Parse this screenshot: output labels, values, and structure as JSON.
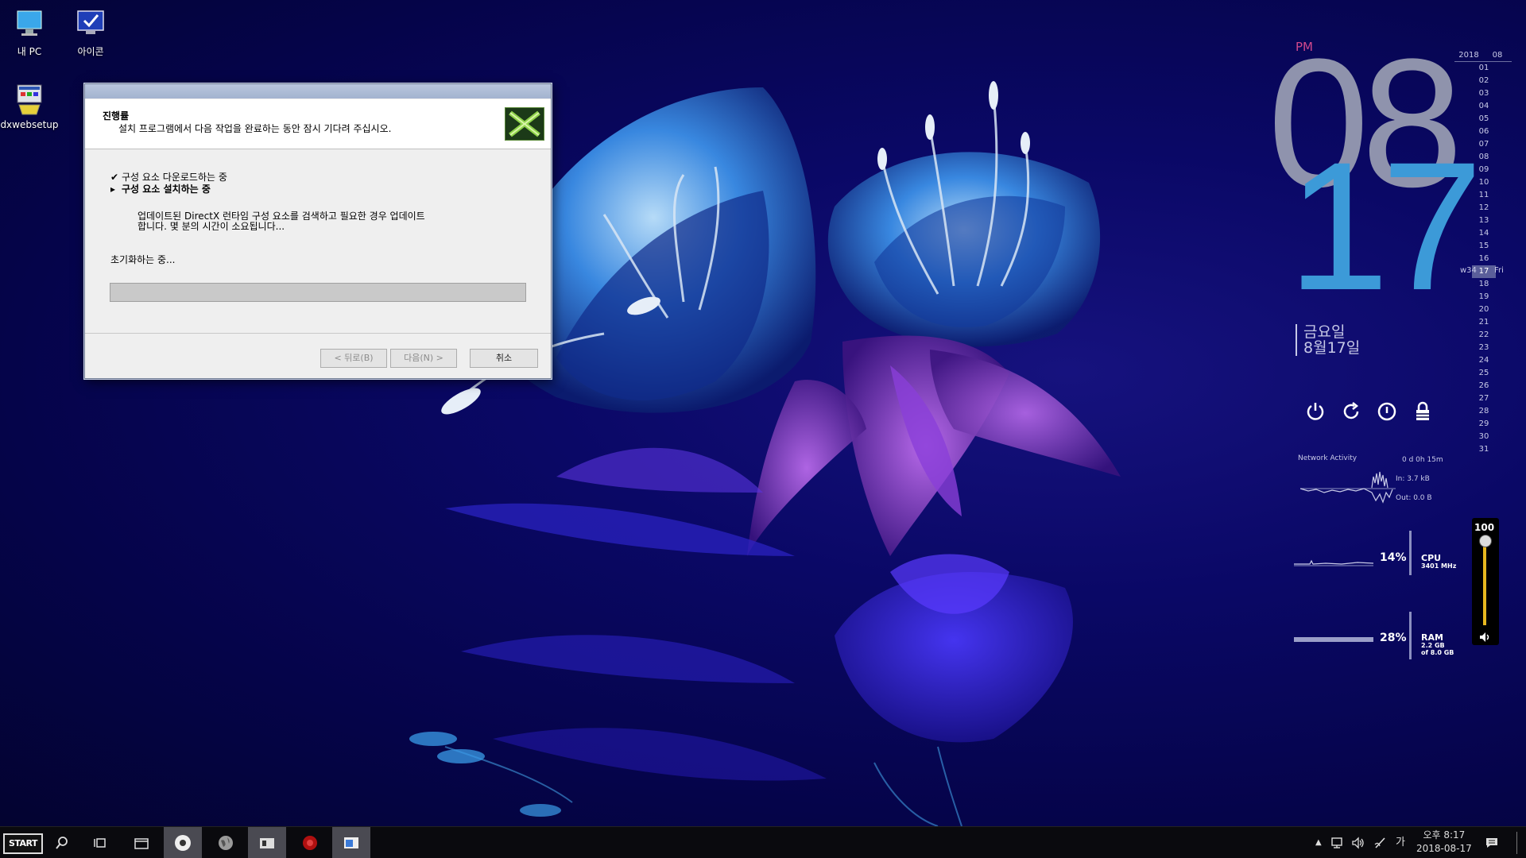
{
  "desktop": {
    "icons": [
      {
        "label": "내 PC",
        "icon": "computer-icon"
      },
      {
        "label": "아이콘",
        "icon": "monitor-check-icon"
      },
      {
        "label": "dxwebsetup",
        "icon": "installer-icon"
      }
    ]
  },
  "dialog": {
    "title": "",
    "heading": "진행률",
    "subheading": "설치 프로그램에서 다음 작업을 완료하는 동안 잠시 기다려 주십시오.",
    "steps": [
      {
        "label": "구성 요소 다운로드하는 중",
        "marker": "✔",
        "state": "done"
      },
      {
        "label": "구성 요소 설치하는 중",
        "marker": "▸",
        "state": "current"
      }
    ],
    "description_line1": "업데이트된 DirectX 런타임 구성 요소를 검색하고 필요한 경우 업데이트",
    "description_line2": "합니다. 몇 분의 시간이 소요됩니다...",
    "status": "초기화하는 중...",
    "progress": 0,
    "buttons": {
      "back": "< 뒤로(B)",
      "next": "다음(N) >",
      "cancel": "취소"
    }
  },
  "clock_widget": {
    "ampm": "PM",
    "hour": "08",
    "day_number": "17",
    "weekday": "금요일",
    "date": "8월17일"
  },
  "calendar": {
    "year": "2018",
    "month": "08",
    "days": [
      "01",
      "02",
      "03",
      "04",
      "05",
      "06",
      "07",
      "08",
      "09",
      "10",
      "11",
      "12",
      "13",
      "14",
      "15",
      "16",
      "17",
      "18",
      "19",
      "20",
      "21",
      "22",
      "23",
      "24",
      "25",
      "26",
      "27",
      "28",
      "29",
      "30",
      "31"
    ],
    "today": "17",
    "week_label": "w34",
    "today_weekday": "Fri"
  },
  "power_buttons": [
    {
      "name": "power-icon"
    },
    {
      "name": "restart-icon"
    },
    {
      "name": "logoff-icon"
    },
    {
      "name": "lock-icon"
    }
  ],
  "network": {
    "title": "Network Activity",
    "uptime": "0 d 0h 15m",
    "in": "In: 3.7 kB",
    "out": "Out: 0.0 B"
  },
  "cpu": {
    "percent": "14%",
    "label": "CPU",
    "sub": "3401 MHz"
  },
  "ram": {
    "percent": "28%",
    "label": "RAM",
    "sub1": "2.2 GB",
    "sub2": "of 8.0 GB"
  },
  "volume": {
    "value": "100",
    "level": 1.0
  },
  "taskbar": {
    "start_label": "START",
    "items": [
      "search-icon",
      "task-view-icon",
      "file-explorer-icon",
      "app-circle-icon",
      "globe-icon",
      "folder-app-icon",
      "media-app-icon",
      "window-app-icon"
    ],
    "ime": "가",
    "time": "오후 8:17",
    "date": "2018-08-17"
  },
  "colors": {
    "accent_blue": "#3c9ad8",
    "pm_pink": "#d0488c",
    "progress_green": "#3fa13f",
    "volume_yellow": "#e8b81f"
  }
}
